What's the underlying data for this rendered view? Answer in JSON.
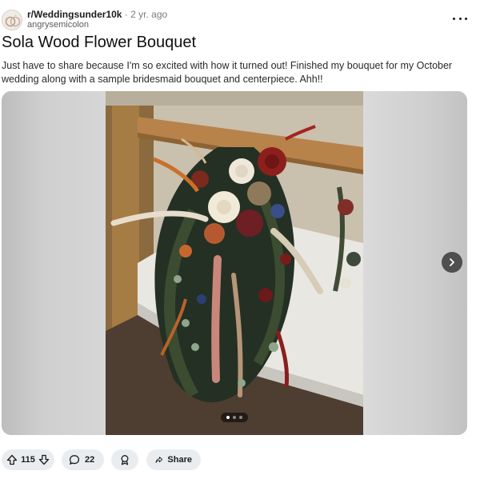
{
  "post": {
    "subreddit": "r/Weddingsunder10k",
    "separator": "·",
    "age": "2 yr. ago",
    "username": "angrysemicolon",
    "title": "Sola Wood Flower Bouquet",
    "body": "Just have to share because I'm so excited with how it turned out! Finished my bouquet for my October wedding along with a sample bridesmaid bouquet and centerpiece. Ahh!!"
  },
  "media": {
    "current_slide": 1,
    "slide_count": 3
  },
  "actions": {
    "upvotes": "115",
    "comments": "22",
    "share_label": "Share"
  },
  "icons": {
    "more": "ellipsis-icon",
    "next": "chevron-right-icon",
    "upvote": "arrow-up-icon",
    "downvote": "arrow-down-icon",
    "comment": "speech-bubble-icon",
    "award": "award-icon",
    "share": "share-arrow-icon"
  },
  "colors": {
    "pill_background": "#eaedef",
    "nav_button": "#4f4f4f"
  }
}
